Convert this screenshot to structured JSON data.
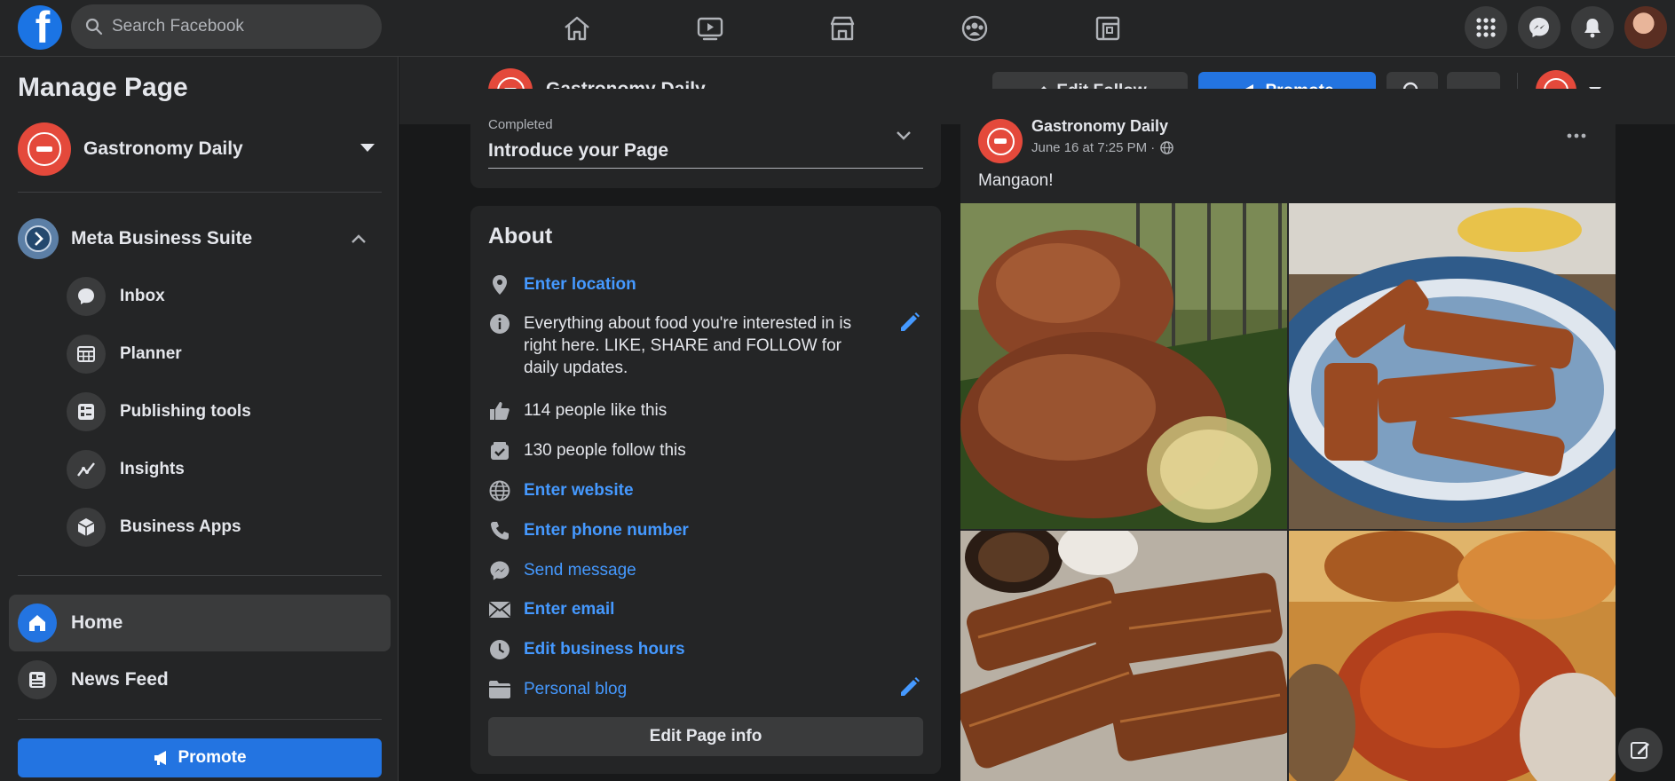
{
  "topbar": {
    "search_placeholder": "Search Facebook",
    "logo_letter": "f"
  },
  "sidebar": {
    "title": "Manage Page",
    "page_name": "Gastronomy Daily",
    "business_suite": "Meta Business Suite",
    "suite_items": [
      {
        "label": "Inbox",
        "icon": "inbox-icon"
      },
      {
        "label": "Planner",
        "icon": "planner-icon"
      },
      {
        "label": "Publishing tools",
        "icon": "publishing-tools-icon"
      },
      {
        "label": "Insights",
        "icon": "insights-icon"
      },
      {
        "label": "Business Apps",
        "icon": "business-apps-icon"
      }
    ],
    "home_label": "Home",
    "news_feed_label": "News Feed",
    "promote_label": "Promote"
  },
  "pagebar": {
    "page_name": "Gastronomy Daily",
    "edit_follow_label": "Edit Follow",
    "promote_label": "Promote"
  },
  "intro": {
    "status": "Completed",
    "title": "Introduce your Page"
  },
  "about": {
    "title": "About",
    "location": "Enter location",
    "description": "Everything about food you're interested in is right here. LIKE, SHARE and FOLLOW for daily updates.",
    "likes": "114 people like this",
    "follows": "130 people follow this",
    "website": "Enter website",
    "phone": "Enter phone number",
    "message": "Send message",
    "email": "Enter email",
    "hours": "Edit business hours",
    "category": "Personal blog",
    "edit_button": "Edit Page info"
  },
  "post": {
    "author": "Gastronomy Daily",
    "timestamp": "June 16 at 7:25 PM ·",
    "text": "Mangaon!"
  },
  "colors": {
    "accent_blue": "#2374e1",
    "link_blue": "#4599ff",
    "brand_red": "#e4493b"
  }
}
